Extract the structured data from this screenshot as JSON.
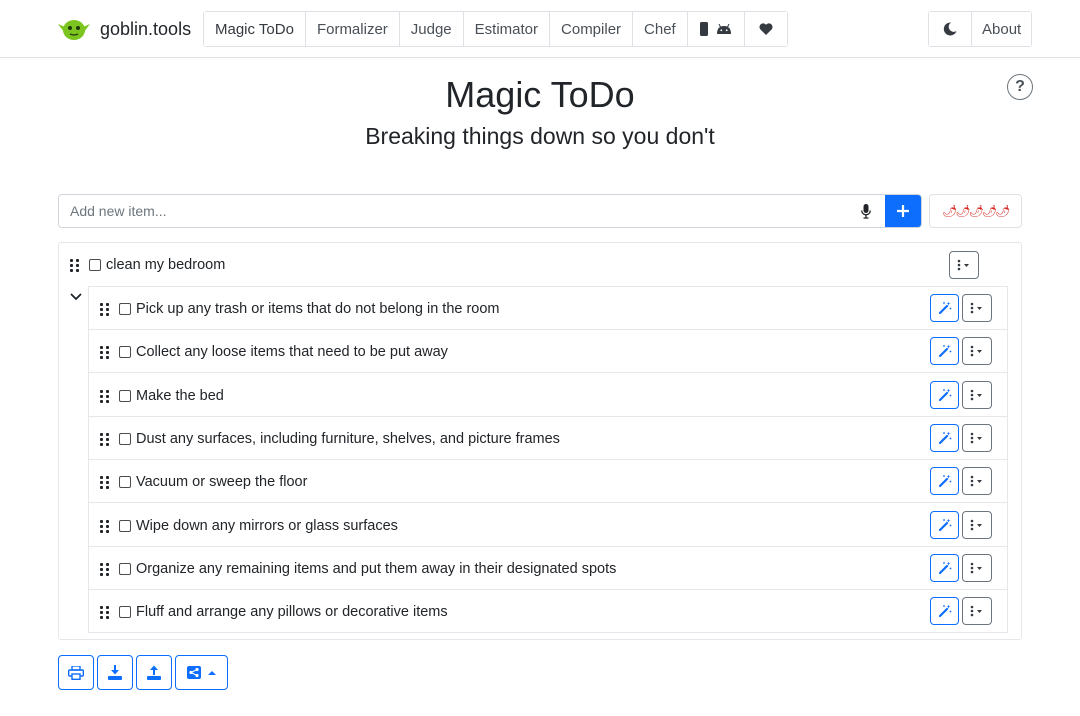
{
  "brand": {
    "name": "goblin.tools",
    "logo_icon": "goblin-logo-icon",
    "logo_color": "#7cc520"
  },
  "nav": {
    "tools": [
      "Magic ToDo",
      "Formalizer",
      "Judge",
      "Estimator",
      "Compiler",
      "Chef"
    ],
    "app_icons": [
      "phone-icon",
      "android-icon"
    ],
    "donate_icon": "heart-icon",
    "theme_icon": "moon-icon",
    "about": "About"
  },
  "header": {
    "title": "Magic ToDo",
    "subtitle": "Breaking things down so you don't",
    "help_label": "?"
  },
  "add_item": {
    "placeholder": "Add new item...",
    "mic_icon": "microphone-icon",
    "add_icon": "plus-icon",
    "spiciness": "🌶🌶🌶🌶🌶"
  },
  "colors": {
    "accent": "#0d6efd",
    "border": "#dee2e6",
    "pepper": "#d6231c"
  },
  "task": {
    "label": "clean my bedroom",
    "expanded": true,
    "subtasks": [
      {
        "label": "Pick up any trash or items that do not belong in the room"
      },
      {
        "label": "Collect any loose items that need to be put away"
      },
      {
        "label": "Make the bed"
      },
      {
        "label": "Dust any surfaces, including furniture, shelves, and picture frames"
      },
      {
        "label": "Vacuum or sweep the floor"
      },
      {
        "label": "Wipe down any mirrors or glass surfaces"
      },
      {
        "label": "Organize any remaining items and put them away in their designated spots"
      },
      {
        "label": "Fluff and arrange any pillows or decorative items"
      }
    ]
  },
  "toolbar": {
    "icons": [
      "print-icon",
      "download-icon",
      "upload-icon",
      "share-icon"
    ]
  }
}
